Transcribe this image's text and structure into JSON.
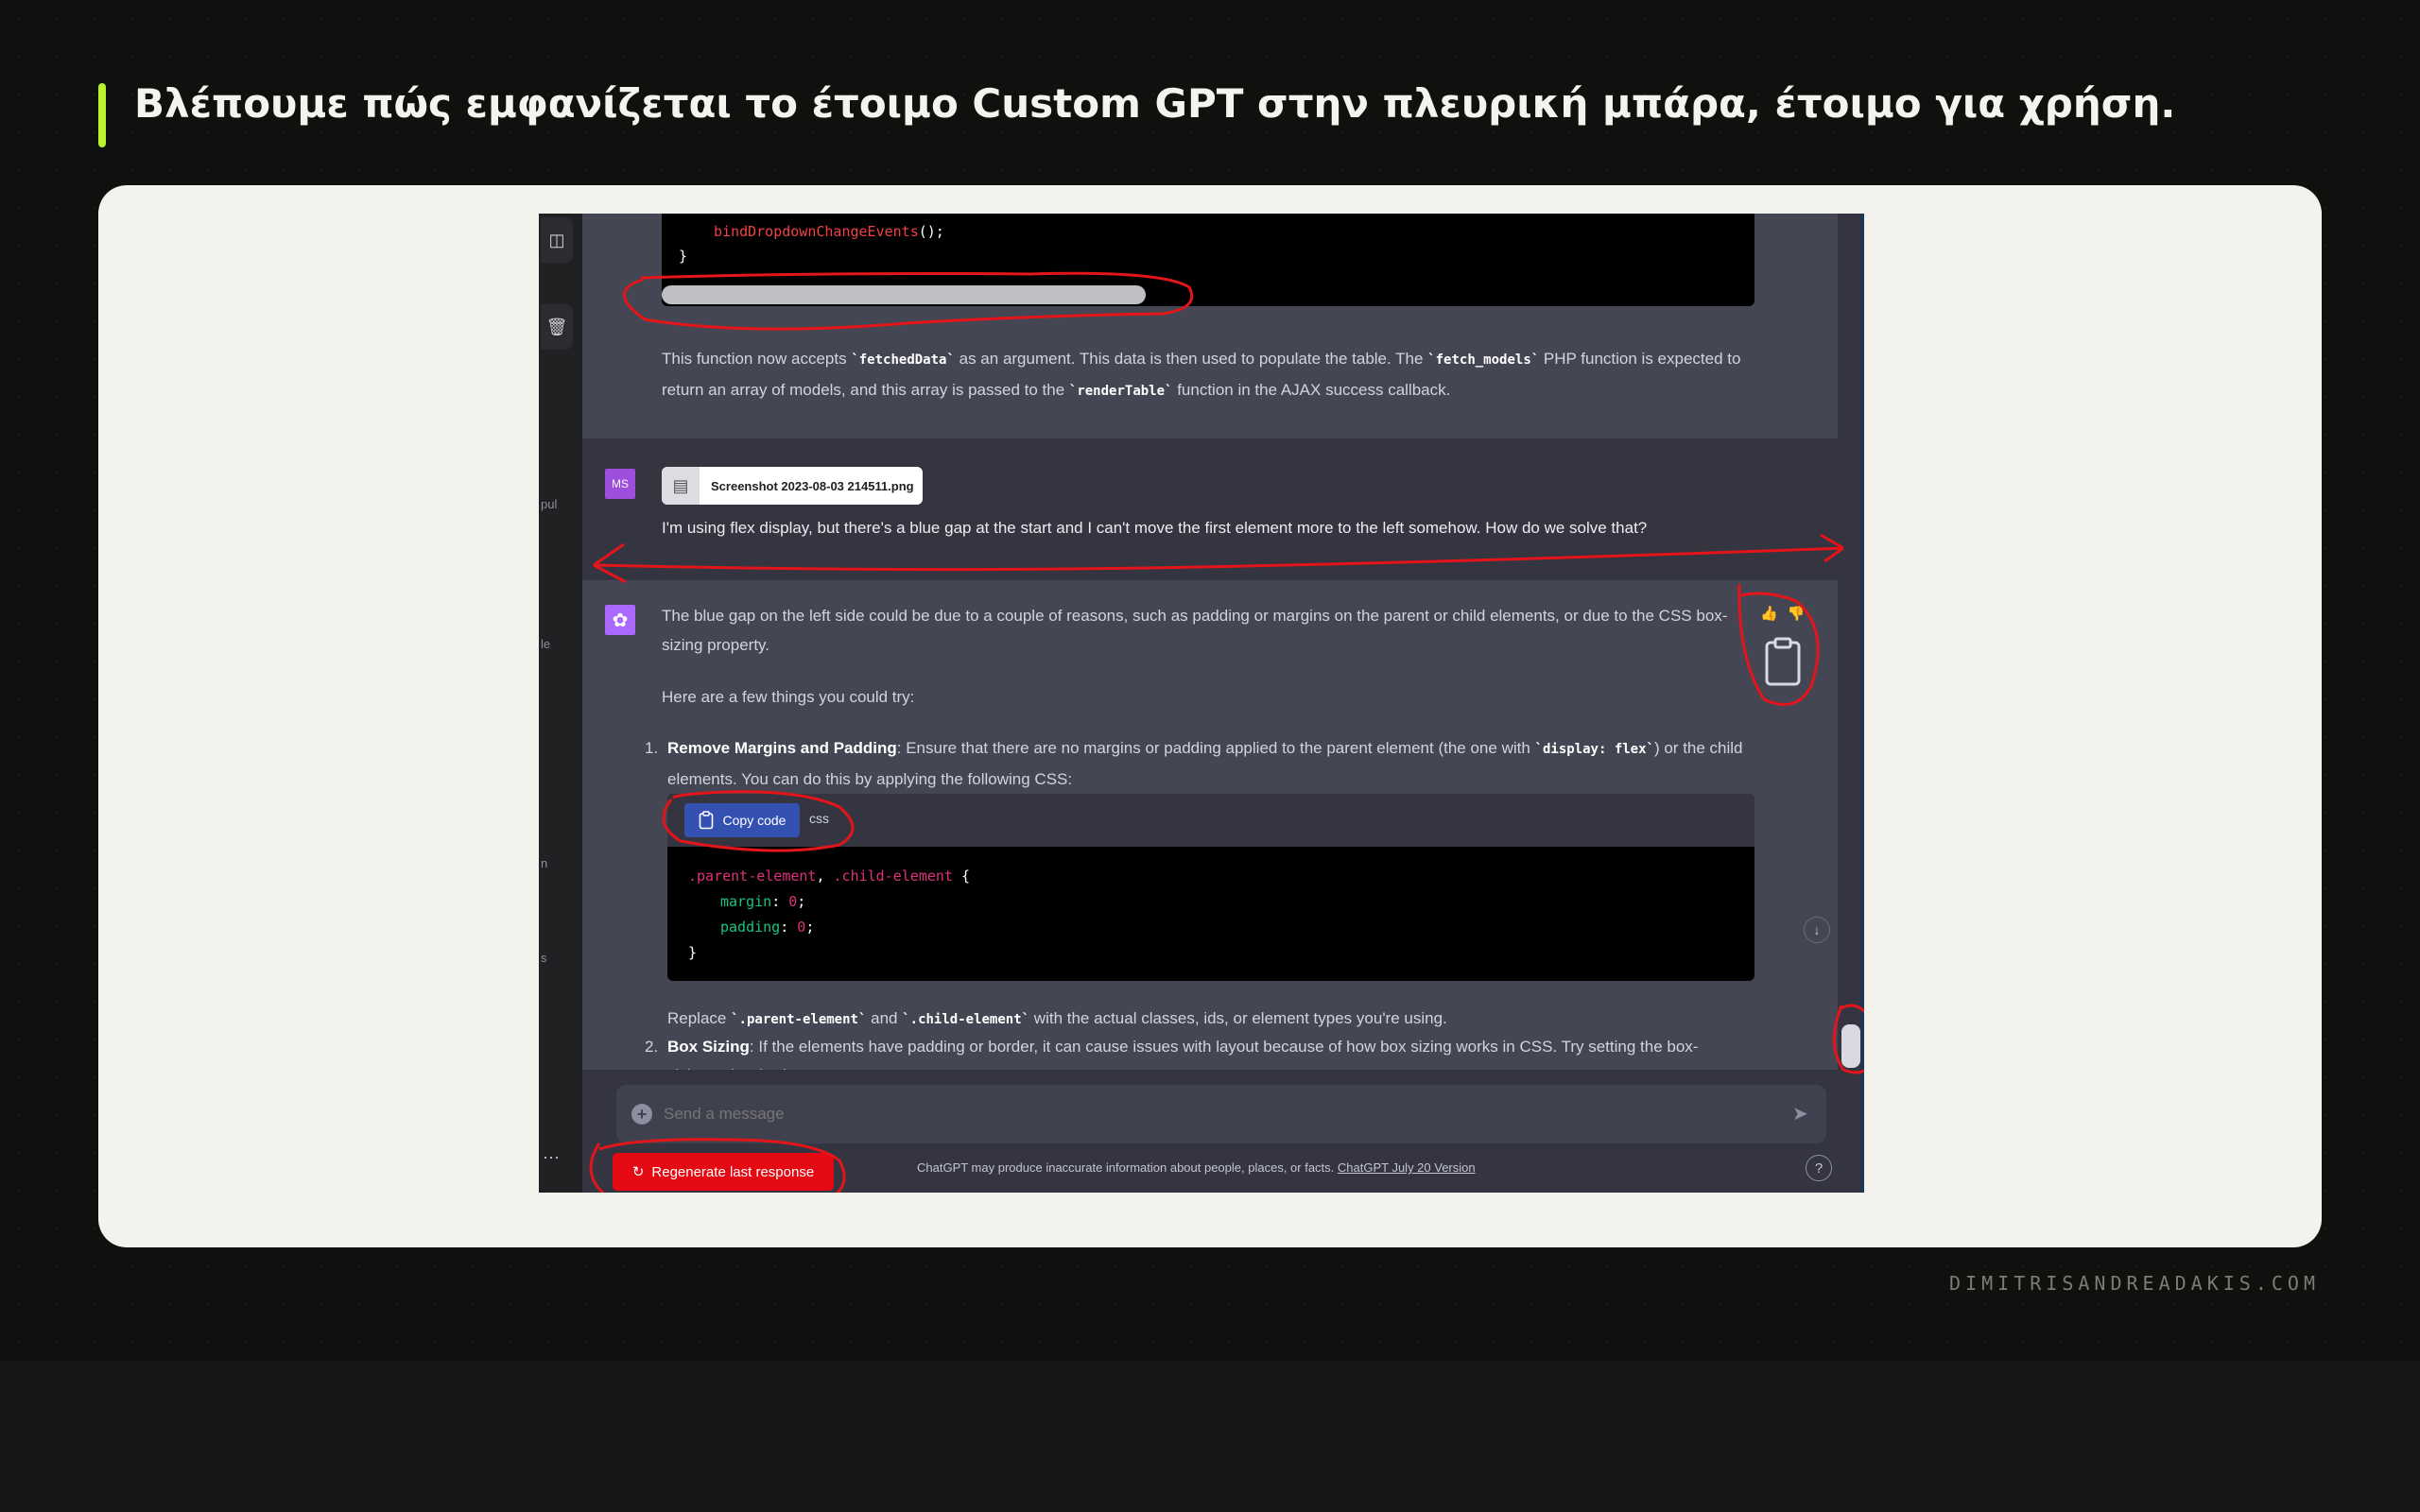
{
  "slide": {
    "title": "Βλέπουμε πώς εμφανίζεται το έτοιμο Custom GPT στην πλευρική μπάρα, έτοιμο για χρήση.",
    "footer": "DIMITRISANDREADAKIS.COM"
  },
  "sidebar": {
    "fragments": [
      "pul",
      "le",
      "n",
      "s"
    ],
    "more": "···"
  },
  "chat": {
    "code_top": {
      "line1_fn": "bindDropdownChangeEvents",
      "line1_rest": "();",
      "line2": "}"
    },
    "ai1": {
      "p_a": "This function now accepts ",
      "code_a": "`fetchedData`",
      "p_b": " as an argument. This data is then used to populate the table. The ",
      "code_b": "`fetch_models`",
      "p_c": " PHP function is expected to return an array of models, and this array is passed to the ",
      "code_c": "`renderTable`",
      "p_d": " function in the AJAX success callback."
    },
    "user": {
      "avatar": "MS",
      "file_name": "Screenshot 2023-08-03 214511.png",
      "text": "I'm using flex display, but there's a blue gap at the start and I can't move the first element more to the left somehow. How do we solve that?"
    },
    "ai2": {
      "p1": "The blue gap on the left side could be due to a couple of reasons, such as padding or margins on the parent or child elements, or due to the CSS box-sizing property.",
      "p2": "Here are a few things you could try:",
      "li1_num": "1.",
      "li1_title": "Remove Margins and Padding",
      "li1_a": ": Ensure that there are no margins or padding applied to the parent element (the one with ",
      "li1_code": "`display: flex`",
      "li1_b": ") or the child elements. You can do this by applying the following CSS:",
      "copy_label": "Copy code",
      "lang": "css",
      "code": {
        "sel1": ".parent-element",
        "comma": ", ",
        "sel2": ".child-element",
        "open": " {",
        "prop1": "margin",
        "prop2": "padding",
        "val": "0",
        "close": "}"
      },
      "replace_a": "Replace ",
      "replace_code1": "`.parent-element`",
      "replace_and": " and ",
      "replace_code2": "`.child-element`",
      "replace_b": " with the actual classes, ids, or element types you're using.",
      "li2_num": "2.",
      "li2_title": "Box Sizing",
      "li2_text": ": If the elements have padding or border, it can cause issues with layout because of how box sizing works in CSS. Try setting the box-",
      "li2_cont": "sizing to border-box"
    },
    "input": {
      "placeholder": "Send a message"
    },
    "regenerate": "Regenerate  last response",
    "disclaimer": "ChatGPT may produce inaccurate information about people, places, or facts. ",
    "disclaimer_link": "ChatGPT July 20 Version",
    "help": "?"
  },
  "colors": {
    "accent": "#b9f22e",
    "annotation": "#e3151a",
    "copy_button": "#3451b2",
    "regenerate": "#e50913"
  }
}
